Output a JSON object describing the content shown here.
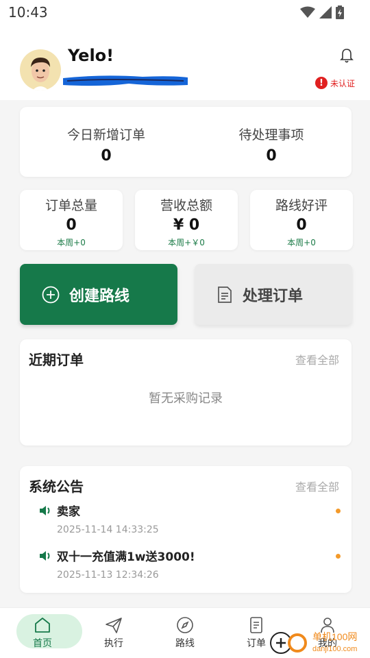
{
  "statusbar": {
    "time": "10:43"
  },
  "header": {
    "greeting": "Yelo!",
    "verification": {
      "badge": "!",
      "label": "未认证"
    }
  },
  "today": [
    {
      "label": "今日新增订单",
      "value": "0"
    },
    {
      "label": "待处理事项",
      "value": "0"
    }
  ],
  "stats": [
    {
      "label": "订单总量",
      "value": "0",
      "weekly": "本周+0"
    },
    {
      "label": "营收总额",
      "value": "¥ 0",
      "weekly": "本周+￥0"
    },
    {
      "label": "路线好评",
      "value": "0",
      "weekly": "本周+0"
    }
  ],
  "actions": {
    "create_route": "创建路线",
    "process_orders": "处理订单"
  },
  "recent_orders": {
    "title": "近期订单",
    "view_all": "查看全部",
    "empty": "暂无采购记录"
  },
  "announcements": {
    "title": "系统公告",
    "view_all": "查看全部",
    "items": [
      {
        "title": "卖家",
        "time": "2025-11-14 14:33:25"
      },
      {
        "title": "双十一充值满1w送3000!",
        "time": "2025-11-13 12:34:26"
      }
    ]
  },
  "tabs": [
    {
      "label": "首页",
      "icon": "home-icon",
      "active": true
    },
    {
      "label": "执行",
      "icon": "send-icon"
    },
    {
      "label": "路线",
      "icon": "compass-icon"
    },
    {
      "label": "订单",
      "icon": "document-icon"
    },
    {
      "label": "我的",
      "icon": "user-icon"
    }
  ],
  "watermark": {
    "text": "单机100网",
    "url": "danji100.com"
  },
  "colors": {
    "primary": "#16794a",
    "primary_light": "#d9f2e1",
    "warning": "#e02020",
    "dot": "#f39a2a"
  }
}
